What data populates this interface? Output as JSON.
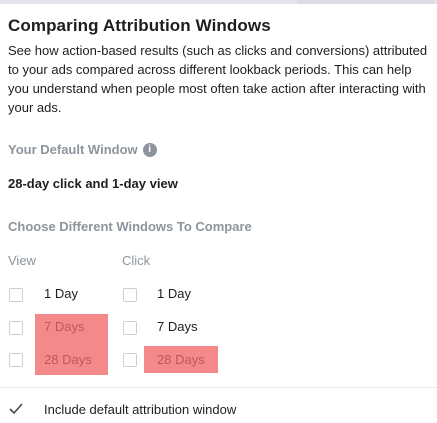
{
  "title": "Comparing Attribution Windows",
  "description": "See how action-based results (such as clicks and conversions) attributed to your ads compared across different lookback periods. This can help you understand when people most often take action after interacting with your ads.",
  "default_window": {
    "label": "Your Default Window",
    "info_icon": "info-icon",
    "value": "28-day click and 1-day view"
  },
  "compare": {
    "label": "Choose Different Windows To Compare",
    "view": {
      "header": "View",
      "options": [
        {
          "label": "1 Day",
          "checked": false,
          "highlighted": false
        },
        {
          "label": "7 Days",
          "checked": false,
          "highlighted": true
        },
        {
          "label": "28 Days",
          "checked": false,
          "highlighted": true
        }
      ]
    },
    "click": {
      "header": "Click",
      "options": [
        {
          "label": "1 Day",
          "checked": false,
          "highlighted": false
        },
        {
          "label": "7 Days",
          "checked": false,
          "highlighted": false
        },
        {
          "label": "28 Days",
          "checked": false,
          "highlighted": true
        }
      ]
    }
  },
  "include_default": {
    "label": "Include default attribution window",
    "checked": true
  },
  "colors": {
    "highlight": "#f4898a",
    "muted_text": "#8d949e",
    "text": "#1c1e21"
  }
}
